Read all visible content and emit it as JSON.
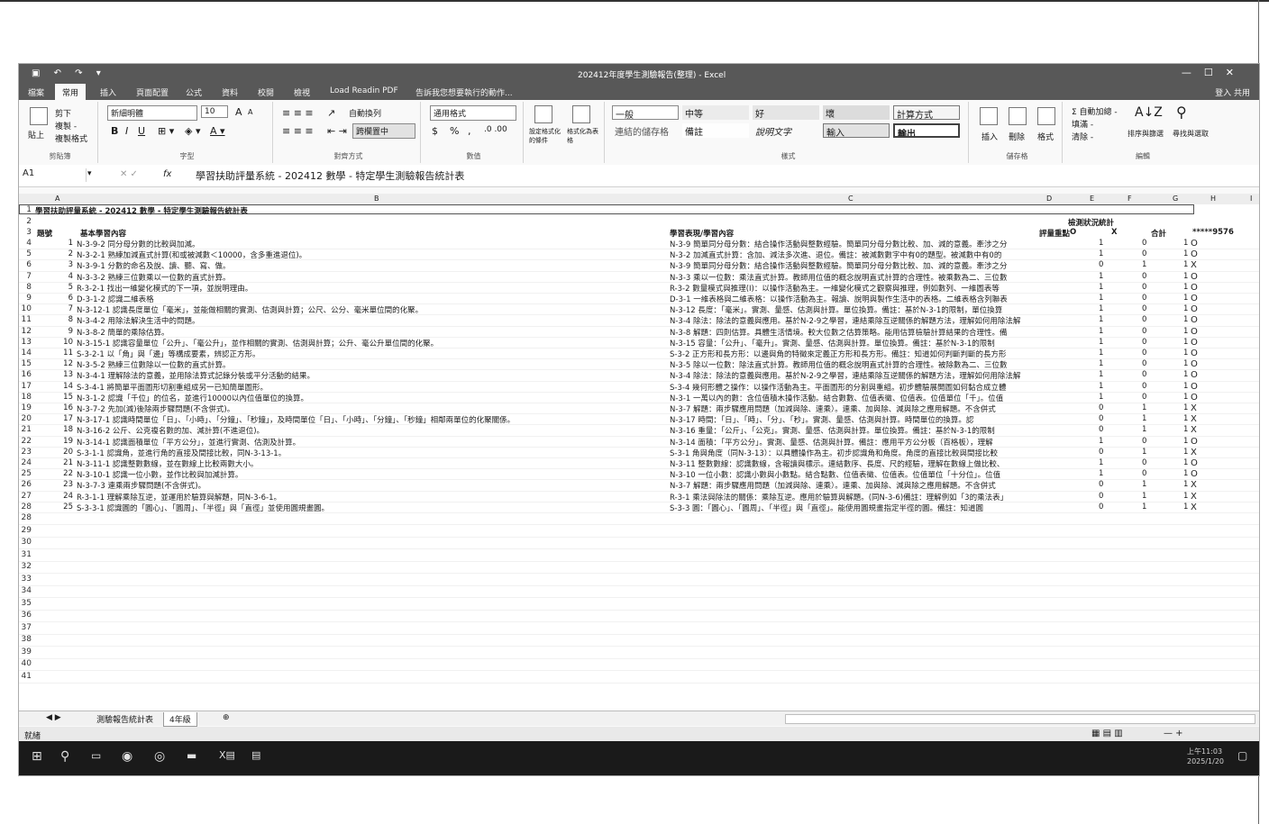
{
  "window": {
    "title": "202412年度學生測驗報告(整理) - Excel",
    "controls": [
      "—",
      "☐",
      "✕"
    ]
  },
  "tabs": {
    "items": [
      "檔案",
      "常用",
      "插入",
      "頁面配置",
      "公式",
      "資料",
      "校閱",
      "檢視",
      "Load Readin PDF",
      "告訴我您想要執行的動作..."
    ],
    "active_index": 1,
    "user": "登入  共用"
  },
  "ribbon": {
    "clipboard": {
      "paste": "貼上",
      "cut": "剪下",
      "copy": "複製 -",
      "painter": "複製格式",
      "label": "剪貼簿"
    },
    "font": {
      "name": "新細明體",
      "size": "10",
      "grow": "A",
      "shrink": "A",
      "bold": "B",
      "italic": "I",
      "underline": "U",
      "label": "字型"
    },
    "align": {
      "wrap": "自動換列",
      "merge": "跨欄置中",
      "label": "對齊方式"
    },
    "number": {
      "format": "通用格式",
      "currency": "$",
      "percent": "%",
      "comma": ",",
      "label": "數值"
    },
    "cond": {
      "conditional": "設定格式化的條件",
      "as_table": "格式化為表格"
    },
    "styles": {
      "cells": [
        "一般",
        "中等",
        "好",
        "壞",
        "計算方式",
        "連結的儲存格",
        "備註",
        "說明文字",
        "輸入",
        "輸出"
      ],
      "label": "樣式"
    },
    "cells": {
      "insert": "插入",
      "delete": "刪除",
      "format": "格式",
      "label": "儲存格"
    },
    "editing": {
      "autosum": "Σ 自動加總 -",
      "fill": "填滿 -",
      "clear": "清除 -",
      "sort": "排序與篩選",
      "find": "尋找與選取",
      "label": "編輯"
    }
  },
  "formula_bar": {
    "cell_ref": "A1",
    "fx": "fx",
    "content": "學習扶助評量系統 - 202412 數學 - 特定學生測驗報告統計表"
  },
  "columns": [
    "A",
    "B",
    "C",
    "D",
    "E",
    "F",
    "G",
    "H",
    "I"
  ],
  "sheet": {
    "title_row": "學習扶助評量系統 - 202412 數學 - 特定學生測驗報告統計表",
    "header_stat": "檢測狀況統計",
    "headers": {
      "num": "題號",
      "basic": "基本學習內容",
      "perf": "學習表現/學習內容",
      "score": "評量重點",
      "o": "O",
      "x": "X",
      "total": "合計",
      "student": "*****9576"
    },
    "rows": [
      {
        "n": "1",
        "basic": "N-3-9-2 同分母分數的比較與加減。",
        "perf": "N-3-9 簡單同分母分數：結合操作活動與整數經驗。簡單同分母分數比較、加、減的意義。牽涉之分",
        "o": "1",
        "x": "0",
        "t": "1",
        "r": "O"
      },
      {
        "n": "2",
        "basic": "N-3-2-1 熟練加減直式計算(和或被減數＜10000，含多重進退位)。",
        "perf": "N-3-2 加減直式計算：含加、減法多次進、退位。備註：被減數數字中有0的題型。被減數中有0的",
        "o": "1",
        "x": "0",
        "t": "1",
        "r": "O"
      },
      {
        "n": "3",
        "basic": "N-3-9-1 分數的命名及說、讀、聽、寫、做。",
        "perf": "N-3-9 簡單同分母分數：結合操作活動與整數經驗。簡單同分母分數比較、加、減的意義。牽涉之分",
        "o": "0",
        "x": "1",
        "t": "1",
        "r": "X"
      },
      {
        "n": "4",
        "basic": "N-3-3-2 熟練三位數乘以一位數的直式計算。",
        "perf": "N-3-3 乘以一位數：乘法直式計算。教師用位值的概念說明直式計算的合理性。被乘數為二、三位數",
        "o": "1",
        "x": "0",
        "t": "1",
        "r": "O"
      },
      {
        "n": "5",
        "basic": "R-3-2-1 找出一維變化模式的下一項，並說明理由。",
        "perf": "R-3-2 數量模式與推理(I)：以操作活動為主。一維變化模式之觀察與推理，例如數列、一維圖表等",
        "o": "1",
        "x": "0",
        "t": "1",
        "r": "O"
      },
      {
        "n": "6",
        "basic": "D-3-1-2 認識二維表格",
        "perf": "D-3-1 一維表格與二維表格：以操作活動為主。報讀、說明與製作生活中的表格。二維表格含列聯表",
        "o": "1",
        "x": "0",
        "t": "1",
        "r": "O"
      },
      {
        "n": "7",
        "basic": "N-3-12-1 認識長度單位「毫米」，並能做相關的實測、估測與計算；公尺、公分、毫米單位間的化聚。",
        "perf": "N-3-12 長度：「毫米」。實測、量感、估測與計算。單位換算。備註：基於N-3-1的限制，單位換算",
        "o": "1",
        "x": "0",
        "t": "1",
        "r": "O"
      },
      {
        "n": "8",
        "basic": "N-3-4-2 用除法解決生活中的問題。",
        "perf": "N-3-4 除法：除法的意義與應用。基於N-2-9之學習，連結乘除互逆關係的解題方法，理解如何用除法解",
        "o": "1",
        "x": "0",
        "t": "1",
        "r": "O"
      },
      {
        "n": "9",
        "basic": "N-3-8-2 簡單的乘除估算。",
        "perf": "N-3-8 解題：四則估算。具體生活情境。較大位數之估算策略。能用估算檢驗計算結果的合理性。備",
        "o": "1",
        "x": "0",
        "t": "1",
        "r": "O"
      },
      {
        "n": "10",
        "basic": "N-3-15-1 認識容量單位「公升」、「毫公升」，並作相關的實測、估測與計算；公升、毫公升單位間的化聚。",
        "perf": "N-3-15 容量：「公升」、「毫升」。實測、量感、估測與計算。單位換算。備註：基於N-3-1的限制",
        "o": "1",
        "x": "0",
        "t": "1",
        "r": "O"
      },
      {
        "n": "11",
        "basic": "S-3-2-1 以「角」與「邊」等構成要素，辨認正方形。",
        "perf": "S-3-2 正方形和長方形：以邊與角的特徵來定義正方形和長方形。備註：知道如何判斷判斷的長方形",
        "o": "1",
        "x": "0",
        "t": "1",
        "r": "O"
      },
      {
        "n": "12",
        "basic": "N-3-5-2 熟練三位數除以一位數的直式計算。",
        "perf": "N-3-5 除以一位數：除法直式計算。教師用位值的概念說明直式計算的合理性。被除數為二、三位數",
        "o": "1",
        "x": "0",
        "t": "1",
        "r": "O"
      },
      {
        "n": "13",
        "basic": "N-3-4-1 理解除法的意義，並用除法算式記錄分裝或平分活動的結果。",
        "perf": "N-3-4 除法：除法的意義與應用。基於N-2-9之學習，連結乘除互逆關係的解題方法，理解如何用除法解",
        "o": "1",
        "x": "0",
        "t": "1",
        "r": "O"
      },
      {
        "n": "14",
        "basic": "S-3-4-1 將簡單平面圖形切割重組成另一已知簡單圖形。",
        "perf": "S-3-4 幾何形體之操作：以操作活動為主。平面圖形的分割與重組。初步體驗展開圖如何黏合成立體",
        "o": "1",
        "x": "0",
        "t": "1",
        "r": "O"
      },
      {
        "n": "15",
        "basic": "N-3-1-2 認識「千位」的位名，並進行10000以內位值單位的換算。",
        "perf": "N-3-1 一萬以內的數：含位值積木操作活動。結合數數、位值表徵、位值表。位值單位「千」。位值",
        "o": "1",
        "x": "0",
        "t": "1",
        "r": "O"
      },
      {
        "n": "16",
        "basic": "N-3-7-2 先加(減)後除兩步驟問題(不含併式)。",
        "perf": "N-3-7 解題：兩步驟應用問題（加減與除、連乘）。連乘、加與除、減與除之應用解題。不含併式",
        "o": "0",
        "x": "1",
        "t": "1",
        "r": "X"
      },
      {
        "n": "17",
        "basic": "N-3-17-1 認識時間單位「日」、「小時」、「分鐘」、「秒鐘」，及時間單位「日」、「小時」、「分鐘」、「秒鐘」相鄰兩單位的化聚關係。",
        "perf": "N-3-17 時間：「日」、「時」、「分」、「秒」。實測、量感、估測與計算。時間單位的換算。認",
        "o": "0",
        "x": "1",
        "t": "1",
        "r": "X"
      },
      {
        "n": "18",
        "basic": "N-3-16-2 公斤、公克複名數的加、減計算(不進退位)。",
        "perf": "N-3-16 重量：「公斤」、「公克」。實測、量感、估測與計算。單位換算。備註：基於N-3-1的限制",
        "o": "0",
        "x": "1",
        "t": "1",
        "r": "X"
      },
      {
        "n": "19",
        "basic": "N-3-14-1 認識面積單位「平方公分」，並進行實測、估測及計算。",
        "perf": "N-3-14 面積：「平方公分」。實測、量感、估測與計算。備註：應用平方公分板（百格板），理解",
        "o": "1",
        "x": "0",
        "t": "1",
        "r": "O"
      },
      {
        "n": "20",
        "basic": "S-3-1-1 認識角，並進行角的直接及間接比較，同N-3-13-1。",
        "perf": "S-3-1 角與角度（同N-3-13）：以具體操作為主。初步認識角和角度。角度的直接比較與間接比較",
        "o": "0",
        "x": "1",
        "t": "1",
        "r": "X"
      },
      {
        "n": "21",
        "basic": "N-3-11-1 認識整數數線，並在數線上比較兩數大小。",
        "perf": "N-3-11 整數數線：認識數線，含報讀與標示。連結數序、長度、尺的經驗，理解在數線上做比較、",
        "o": "1",
        "x": "0",
        "t": "1",
        "r": "O"
      },
      {
        "n": "22",
        "basic": "N-3-10-1 認識一位小數，並作比較與加減計算。",
        "perf": "N-3-10 一位小數：認識小數與小數點。結合點數、位值表徵、位值表。位值單位「十分位」。位值",
        "o": "1",
        "x": "0",
        "t": "1",
        "r": "O"
      },
      {
        "n": "23",
        "basic": "N-3-7-3 連乘兩步驟問題(不含併式)。",
        "perf": "N-3-7 解題：兩步驟應用問題（加減與除、連乘）。連乘、加與除、減與除之應用解題。不含併式",
        "o": "0",
        "x": "1",
        "t": "1",
        "r": "X"
      },
      {
        "n": "24",
        "basic": "R-3-1-1 理解乘除互逆，並運用於驗算與解題，同N-3-6-1。",
        "perf": "R-3-1 乘法與除法的關係：乘除互逆。應用於驗算與解題。(同N-3-6)備註：理解例如「3的乘法表」",
        "o": "0",
        "x": "1",
        "t": "1",
        "r": "X"
      },
      {
        "n": "25",
        "basic": "S-3-3-1 認識圓的「圓心」、「圓周」、「半徑」與「直徑」並使用圓規畫圓。",
        "perf": "S-3-3 圓：「圓心」、「圓周」、「半徑」與「直徑」。能使用圓規畫指定半徑的圓。備註：知道圓",
        "o": "0",
        "x": "1",
        "t": "1",
        "r": "X"
      }
    ],
    "extra_row_numbers": [
      "28",
      "29",
      "30",
      "31",
      "32",
      "33",
      "34",
      "35",
      "36",
      "37",
      "38",
      "39",
      "40",
      "41"
    ]
  },
  "sheet_tabs": {
    "items": [
      "測驗報告統計表",
      "4年級"
    ],
    "active_index": 1,
    "add": "⊕"
  },
  "status": {
    "ready": "就緒",
    "zoom": "—  +",
    "view_icons": "▦ ▤ ▥"
  },
  "taskbar": {
    "start": "⊞",
    "search": "⚲",
    "time": "上午11:03",
    "date": "2025/1/20"
  }
}
